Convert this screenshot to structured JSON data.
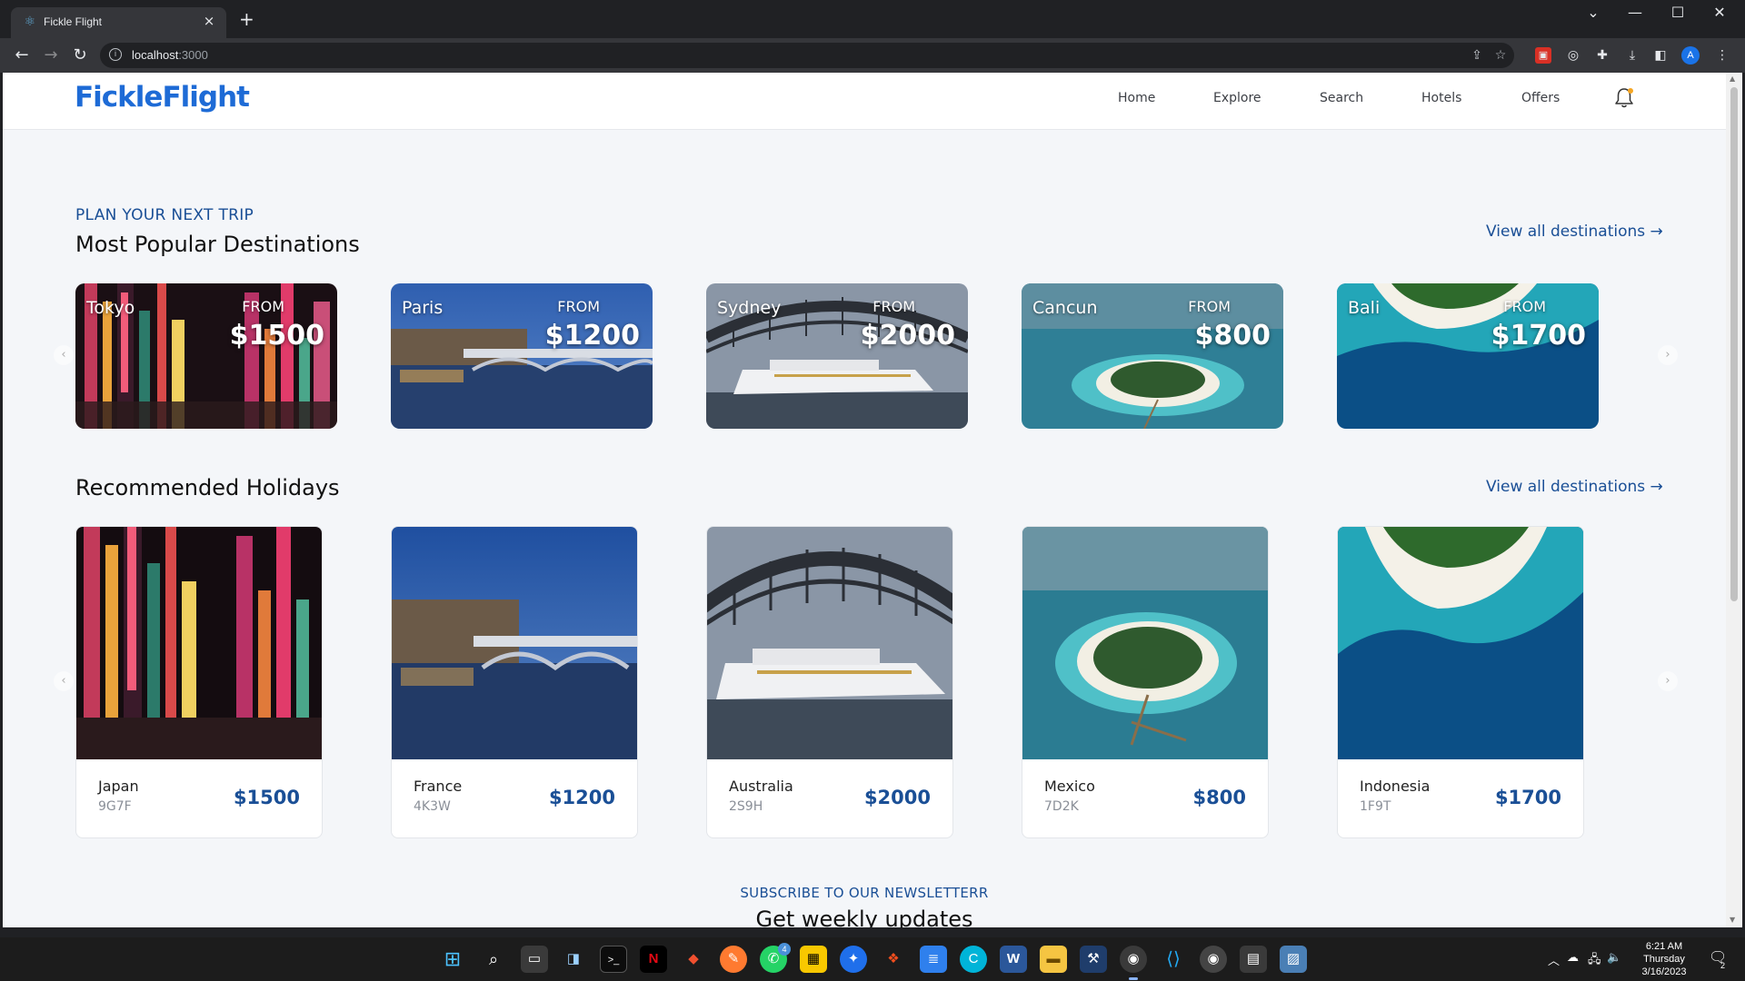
{
  "browser": {
    "tab_title": "Fickle Flight",
    "tab_favicon": "react-atom-icon",
    "tab_close": "×",
    "new_tab": "+",
    "url_host": "localhost",
    "url_port": ":3000",
    "avatar_letter": "A",
    "window_controls": {
      "chevron": "⌄",
      "minimize": "—",
      "maximize": "☐",
      "close": "✕"
    }
  },
  "site": {
    "logo": "FickleFlight",
    "nav": [
      "Home",
      "Explore",
      "Search",
      "Hotels",
      "Offers"
    ],
    "notification_icon": "bell-icon"
  },
  "popular": {
    "eyebrow": "PLAN YOUR NEXT TRIP",
    "title": "Most Popular Destinations",
    "view_all": "View all destinations →",
    "from_label": "FROM",
    "items": [
      {
        "city": "Tokyo",
        "price": "$1500",
        "scene": "neon-city"
      },
      {
        "city": "Paris",
        "price": "$1200",
        "scene": "bridge-night"
      },
      {
        "city": "Sydney",
        "price": "$2000",
        "scene": "harbour-ship"
      },
      {
        "city": "Cancun",
        "price": "$800",
        "scene": "island-aerial"
      },
      {
        "city": "Bali",
        "price": "$1700",
        "scene": "beach-aerial"
      }
    ]
  },
  "recommended": {
    "title": "Recommended Holidays",
    "view_all": "View all destinations →",
    "items": [
      {
        "country": "Japan",
        "code": "9G7F",
        "price": "$1500",
        "scene": "neon-city"
      },
      {
        "country": "France",
        "code": "4K3W",
        "price": "$1200",
        "scene": "bridge-night"
      },
      {
        "country": "Australia",
        "code": "2S9H",
        "price": "$2000",
        "scene": "harbour-ship"
      },
      {
        "country": "Mexico",
        "code": "7D2K",
        "price": "$800",
        "scene": "island-aerial"
      },
      {
        "country": "Indonesia",
        "code": "1F9T",
        "price": "$1700",
        "scene": "beach-aerial"
      }
    ]
  },
  "newsletter": {
    "eyebrow": "SUBSCRIBE TO OUR NEWSLETTERR",
    "title": "Get weekly updates"
  },
  "taskbar": {
    "clock_time": "6:21 AM",
    "clock_day": "Thursday",
    "clock_date": "3/16/2023",
    "notification_count": "2",
    "whatsapp_badge": "4"
  },
  "colors": {
    "brand_blue": "#1e6bd6",
    "accent_navy": "#1a4f96",
    "page_bg": "#f4f6f9"
  }
}
